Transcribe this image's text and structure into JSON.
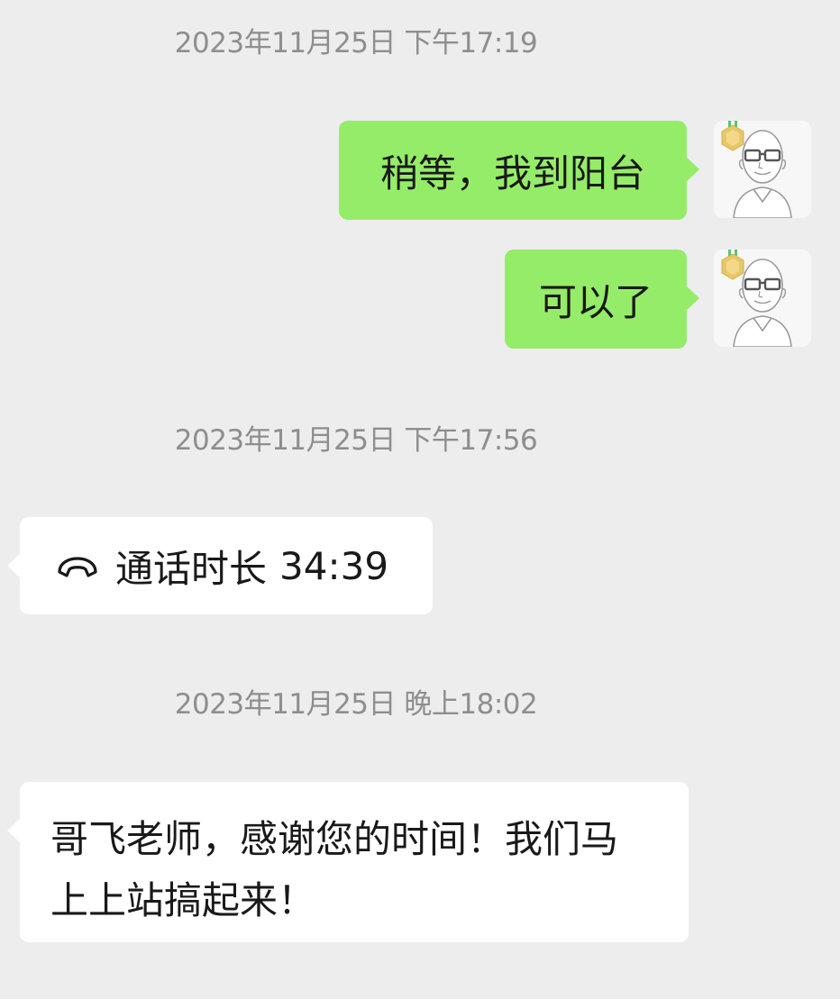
{
  "messages": [
    {
      "type": "timestamp",
      "text": "2023年11月25日 下午17:19"
    },
    {
      "type": "sent",
      "text": "稍等，我到阳台"
    },
    {
      "type": "sent",
      "text": "可以了"
    },
    {
      "type": "timestamp",
      "text": "2023年11月25日 下午17:56"
    },
    {
      "type": "call",
      "icon": "phone-hangup-icon",
      "label": "通话时长",
      "duration": "34:39"
    },
    {
      "type": "timestamp",
      "text": "2023年11月25日 晚上18:02"
    },
    {
      "type": "received",
      "lines": [
        "哥飞老师，感谢您的时间！我们马",
        "上上站搞起来！"
      ]
    }
  ],
  "colors": {
    "background": "#ededed",
    "sent_bubble": "#95ec69",
    "received_bubble": "#ffffff",
    "timestamp_text": "#8e8e8e"
  },
  "icons": {
    "avatar": "bald-man-with-glasses-avatar-icon",
    "badge": "gold-medal-badge-icon",
    "call": "phone-hangup-icon"
  }
}
